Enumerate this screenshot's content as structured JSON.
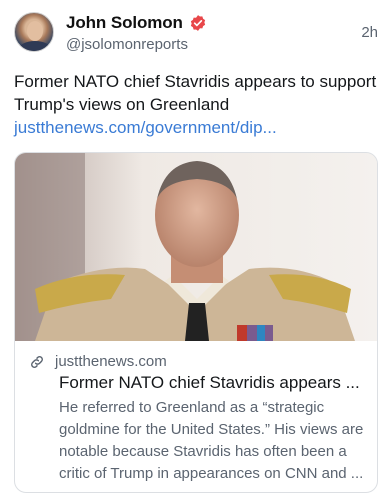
{
  "author": {
    "name": "John Solomon",
    "handle": "@jsolomonreports",
    "verified": true,
    "avatar_icon": "person-portrait-avatar"
  },
  "timestamp": "2h",
  "post": {
    "text": "Former NATO chief Stavridis appears to support Trump's views on Greenland",
    "link": "justthenews.com/government/dip..."
  },
  "link_card": {
    "image_description_icon": "news-photo",
    "domain": "justthenews.com",
    "title": "Former NATO chief Stavridis appears ...",
    "description": "He referred to Greenland as a “strategic goldmine for the United States.” His views are notable because Stavridis has often been a critic of Trump in appearances on CNN and ..."
  },
  "colors": {
    "link": "#3a7bd5",
    "verified_badge": "#e8474a",
    "secondary_text": "#5b6470"
  }
}
